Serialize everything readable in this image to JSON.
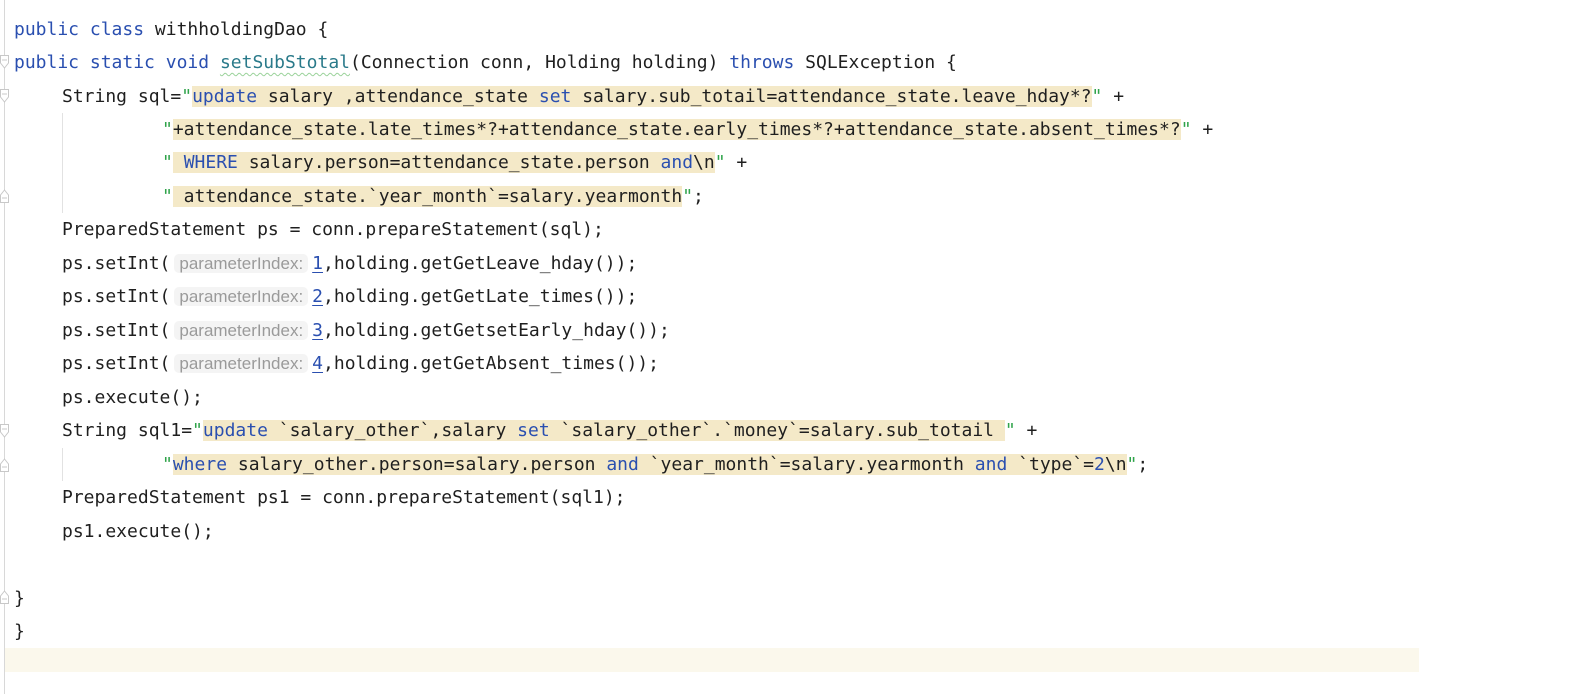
{
  "editor": {
    "lines": {
      "l1": {
        "kw1": "public",
        "kw2": "class",
        "rest": " withholdingDao {"
      },
      "l2": {
        "kw1": "public",
        "kw2": "static",
        "kw3": "void",
        "method": "setSubStotal",
        "params": "(Connection conn, Holding holding) ",
        "kw4": "throws",
        "rest": " SQLException {"
      },
      "l3": {
        "pre": "String sql=",
        "kw": "update",
        "s1": " salary ,attendance_state ",
        "kw2": "set",
        "s2": " salary.sub_totail=attendance_state.leave_hday*?",
        "post": " +"
      },
      "l4": {
        "s": "+attendance_state.late_times*?+attendance_state.early_times*?+attendance_state.absent_times*?",
        "post": " +"
      },
      "l5": {
        "kw": "WHERE",
        "s1": " salary.person=attendance_state.person ",
        "kw2": "and",
        "s2": "\\n",
        "post": " +"
      },
      "l6": {
        "s": " attendance_state.`year_month`=salary.yearmonth",
        "post": ";"
      },
      "l7": {
        "text": "PreparedStatement ps = conn.prepareStatement(sql);"
      },
      "setint": [
        {
          "pre": "ps.setInt(",
          "hint": "parameterIndex:",
          "index": "1",
          "rest": ",holding.getGetLeave_hday());"
        },
        {
          "pre": "ps.setInt(",
          "hint": "parameterIndex:",
          "index": "2",
          "rest": ",holding.getGetLate_times());"
        },
        {
          "pre": "ps.setInt(",
          "hint": "parameterIndex:",
          "index": "3",
          "rest": ",holding.getGetsetEarly_hday());"
        },
        {
          "pre": "ps.setInt(",
          "hint": "parameterIndex:",
          "index": "4",
          "rest": ",holding.getGetAbsent_times());"
        }
      ],
      "l12": {
        "text": "ps.execute();"
      },
      "l13": {
        "pre": "String sql1=",
        "kw": "update",
        "s1": " `salary_other`,salary ",
        "kw2": "set",
        "s2": " `salary_other`.`money`=salary.sub_totail ",
        "post": " +"
      },
      "l14": {
        "kw": "where",
        "s1": " salary_other.person=salary.person ",
        "kw2": "and",
        "s2": " `year_month`=salary.yearmonth ",
        "kw3": "and",
        "s3": " `type`=",
        "num": "2",
        "s4": "\\n",
        "post": ";"
      },
      "l15": {
        "text": "PreparedStatement ps1 = conn.prepareStatement(sql1);"
      },
      "l16": {
        "text": "ps1.execute();"
      },
      "l18": {
        "text": "}"
      },
      "l19": {
        "text": "}"
      }
    },
    "quote": "\""
  }
}
